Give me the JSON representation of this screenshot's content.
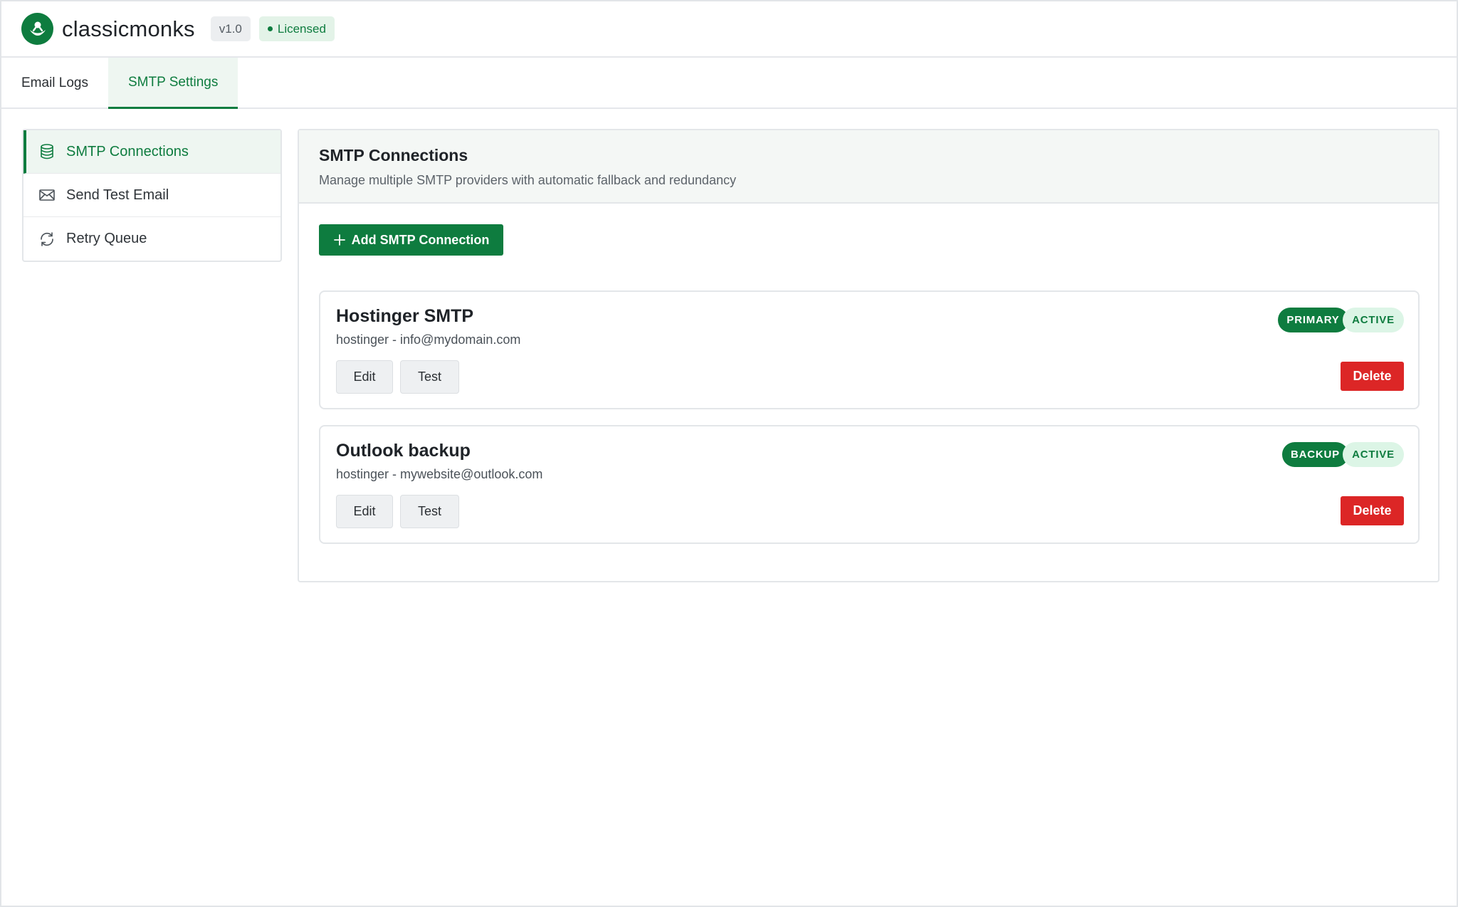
{
  "header": {
    "brand": "classicmonks",
    "version": "v1.0",
    "license": "Licensed"
  },
  "tabs": [
    {
      "label": "Email Logs",
      "active": false
    },
    {
      "label": "SMTP Settings",
      "active": true
    }
  ],
  "sidebar": {
    "items": [
      {
        "label": "SMTP Connections",
        "icon": "database-icon",
        "active": true
      },
      {
        "label": "Send Test Email",
        "icon": "envelope-icon",
        "active": false
      },
      {
        "label": "Retry Queue",
        "icon": "refresh-icon",
        "active": false
      }
    ]
  },
  "main": {
    "title": "SMTP Connections",
    "description": "Manage multiple SMTP providers with automatic fallback and redundancy",
    "add_button": "Add SMTP Connection",
    "connections": [
      {
        "name": "Hostinger SMTP",
        "detail": "hostinger - info@mydomain.com",
        "role": "PRIMARY",
        "status": "ACTIVE",
        "edit": "Edit",
        "test": "Test",
        "delete": "Delete"
      },
      {
        "name": "Outlook backup",
        "detail": "hostinger - mywebsite@outlook.com",
        "role": "BACKUP",
        "status": "ACTIVE",
        "edit": "Edit",
        "test": "Test",
        "delete": "Delete"
      }
    ]
  },
  "colors": {
    "accent": "#0e7c3f",
    "danger": "#dc2626",
    "active_bg": "#eef6f1"
  }
}
